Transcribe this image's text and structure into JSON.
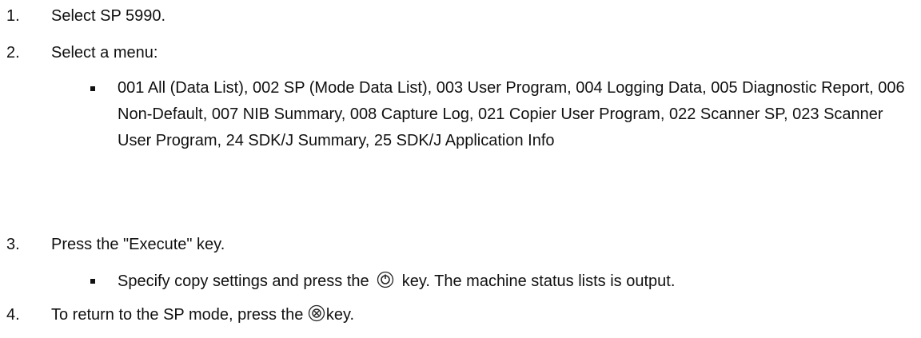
{
  "steps": [
    {
      "number": "1.",
      "text": "Select SP 5990."
    },
    {
      "number": "2.",
      "text": "Select a menu:"
    },
    {
      "number": "3.",
      "text": "Press the \"Execute\" key."
    },
    {
      "number": "4.",
      "text_before": "To return to the SP mode, press the ",
      "text_after": "key."
    }
  ],
  "step2_sub": {
    "text": "001 All (Data List), 002 SP (Mode Data List), 003 User Program, 004 Logging Data, 005 Diagnostic Report, 006 Non-Default, 007 NIB Summary, 008 Capture Log, 021 Copier User Program, 022 Scanner SP, 023 Scanner User Program, 24 SDK/J Summary, 25 SDK/J Application Info"
  },
  "step3_sub": {
    "text_before": "Specify copy settings and press the ",
    "text_after": " key. The machine status lists is output."
  },
  "icons": {
    "start_key": "start-key-icon",
    "clear_stop_key": "clear-stop-key-icon"
  }
}
